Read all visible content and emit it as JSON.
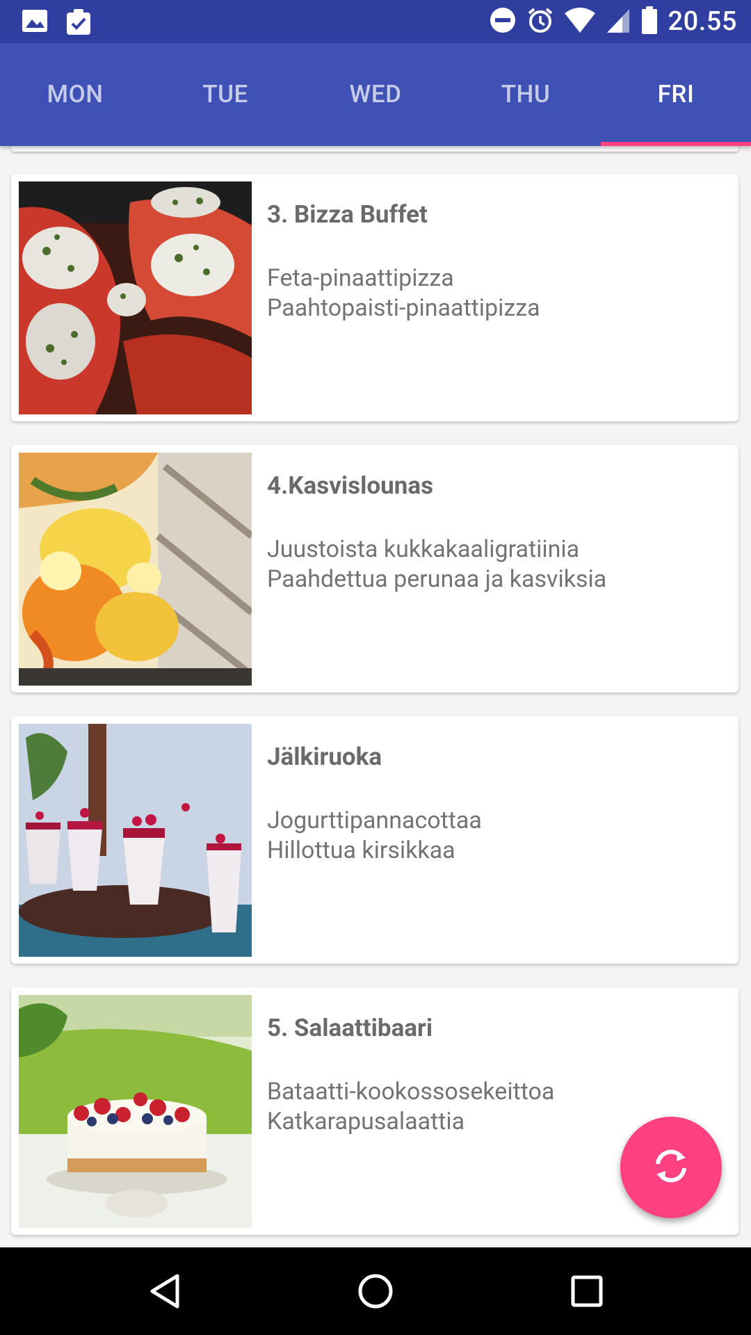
{
  "status_bar": {
    "time": "20.55",
    "left_icons": [
      "image-icon",
      "clipboard-check-icon"
    ],
    "right_icons": [
      "do-not-disturb-icon",
      "alarm-icon",
      "wifi-icon",
      "cell-signal-icon",
      "battery-icon"
    ]
  },
  "tabs": [
    {
      "label": "MON"
    },
    {
      "label": "TUE"
    },
    {
      "label": "WED"
    },
    {
      "label": "THU"
    },
    {
      "label": "FRI"
    }
  ],
  "active_tab": "FRI",
  "menu_items": [
    {
      "title": "3. Bizza Buffet",
      "line1": "Feta-pinaattipizza",
      "line2": "Paahtopaisti-pinaattipizza",
      "image": "pizza-photo"
    },
    {
      "title": "4.Kasvislounas",
      "line1": "Juustoista kukkakaaligratiinia",
      "line2": "Paahdettua perunaa ja kasviksia",
      "image": "vegetable-gratin-photo"
    },
    {
      "title": "Jälkiruoka",
      "line1": "Jogurttipannacottaa",
      "line2": "Hillottua kirsikkaa",
      "image": "panna-cotta-photo"
    },
    {
      "title": "5. Salaattibaari",
      "line1": "Bataatti-kookossosekeittoa",
      "line2": "Katkarapusalaattia",
      "image": "berry-cheesecake-photo"
    }
  ],
  "fab": {
    "icon": "refresh-icon"
  },
  "colors": {
    "primary": "#3f51b5",
    "primary_dark": "#303f9f",
    "accent": "#ff4081"
  },
  "nav": {
    "icons": [
      "back-icon",
      "home-icon",
      "recents-icon"
    ]
  }
}
